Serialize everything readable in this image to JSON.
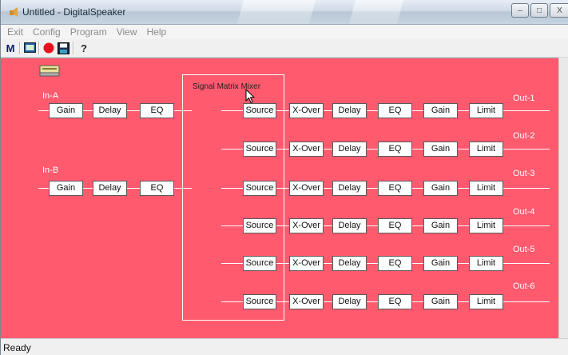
{
  "window": {
    "title": "Untitled - DigitalSpeaker",
    "minimize_label": "‒",
    "maximize_label": "□",
    "close_label": "X"
  },
  "menu": [
    "Exit",
    "Config",
    "Program",
    "View",
    "Help"
  ],
  "toolbar": {
    "tools": [
      {
        "icon": "m-icon",
        "text": "M"
      },
      {
        "icon": "monitor-icon"
      },
      {
        "icon": "record-icon"
      },
      {
        "icon": "save-icon"
      },
      {
        "icon": "help-icon",
        "text": "?"
      }
    ]
  },
  "canvas": {
    "background": "#ff5a6e",
    "inputs": [
      {
        "label": "In-A",
        "blocks": [
          "Gain",
          "Delay",
          "EQ"
        ]
      },
      {
        "label": "In-B",
        "blocks": [
          "Gain",
          "Delay",
          "EQ"
        ]
      }
    ],
    "mixer_label": "Signal Matrix Mixer",
    "outputs": [
      {
        "label": "Out-1",
        "blocks": [
          "Source",
          "X-Over",
          "Delay",
          "EQ",
          "Gain",
          "Limit"
        ]
      },
      {
        "label": "Out-2",
        "blocks": [
          "Source",
          "X-Over",
          "Delay",
          "EQ",
          "Gain",
          "Limit"
        ]
      },
      {
        "label": "Out-3",
        "blocks": [
          "Source",
          "X-Over",
          "Delay",
          "EQ",
          "Gain",
          "Limit"
        ]
      },
      {
        "label": "Out-4",
        "blocks": [
          "Source",
          "X-Over",
          "Delay",
          "EQ",
          "Gain",
          "Limit"
        ]
      },
      {
        "label": "Out-5",
        "blocks": [
          "Source",
          "X-Over",
          "Delay",
          "EQ",
          "Gain",
          "Limit"
        ]
      },
      {
        "label": "Out-6",
        "blocks": [
          "Source",
          "X-Over",
          "Delay",
          "EQ",
          "Gain",
          "Limit"
        ]
      }
    ]
  },
  "status": {
    "text": "Ready"
  }
}
